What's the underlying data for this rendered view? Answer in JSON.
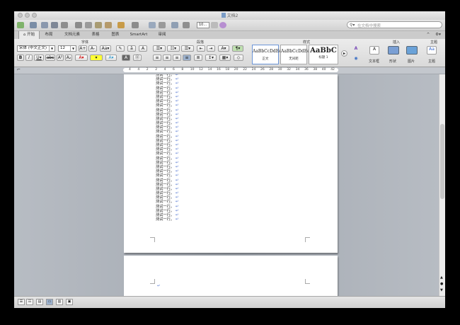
{
  "window": {
    "title": "文档2"
  },
  "search": {
    "placeholder": "在文档中搜索"
  },
  "toolbar": {
    "zoom": "10..."
  },
  "tabs": [
    {
      "label": "开始"
    },
    {
      "label": "布局"
    },
    {
      "label": "文档元素"
    },
    {
      "label": "表格"
    },
    {
      "label": "图表"
    },
    {
      "label": "SmartArt"
    },
    {
      "label": "审阅"
    }
  ],
  "ribbon": {
    "groups": {
      "font": "字体",
      "paragraph": "段落",
      "styles": "样式",
      "insert": "插入",
      "theme": "主题"
    },
    "font_name": "宋体 (中文正文)",
    "font_size": "12",
    "styles": [
      {
        "preview": "AaBbCcDdEe",
        "name": "正文"
      },
      {
        "preview": "AaBbCcDdEe",
        "name": "无间距"
      },
      {
        "preview": "AaBbC",
        "name": "标题 1"
      }
    ],
    "insert_items": [
      "文本框",
      "形状",
      "图片"
    ],
    "theme_item": "主题"
  },
  "ruler": {
    "ticks": [
      "4",
      "4",
      "2",
      "2",
      "4",
      "6",
      "8",
      "10",
      "12",
      "14",
      "16",
      "18",
      "20",
      "22",
      "24",
      "26",
      "28",
      "30",
      "32",
      "34",
      "36",
      "38",
      "40",
      "42"
    ]
  },
  "document": {
    "line_text": "测试一行。",
    "paragraph_mark": "↵"
  },
  "colors": {
    "paragraph_mark": "#3b63c9",
    "ribbon_bg": "#e3e3e3",
    "canvas_bg": "#aab0b8"
  }
}
